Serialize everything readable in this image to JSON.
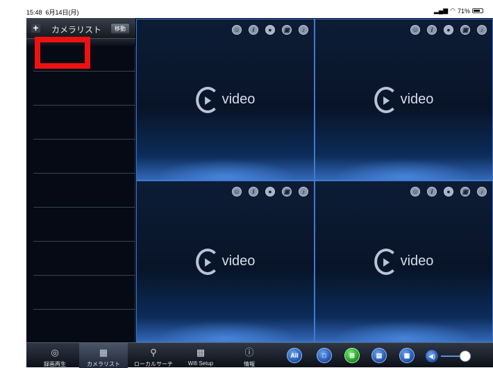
{
  "status": {
    "time": "15:48",
    "date": "6月14日(月)",
    "battery": "71%"
  },
  "sidebar": {
    "title": "カメラリスト",
    "move_label": "移動"
  },
  "video_cells": [
    {
      "label": "video"
    },
    {
      "label": "video"
    },
    {
      "label": "video"
    },
    {
      "label": "video"
    }
  ],
  "cell_icons": [
    "talk-icon",
    "info-icon",
    "record-icon",
    "snapshot-icon",
    "audio-icon"
  ],
  "toolbar": {
    "items": [
      {
        "label": "録画再生",
        "icon": "playback-icon"
      },
      {
        "label": "カメラリスト",
        "icon": "camera-list-icon"
      },
      {
        "label": "ローカルサーチ",
        "icon": "search-icon"
      },
      {
        "label": "Wifi Setup",
        "icon": "qr-code-icon"
      },
      {
        "label": "情報",
        "icon": "info-icon"
      }
    ],
    "all_label": "All"
  },
  "colors": {
    "accent": "#3f7bd0",
    "selected_layout": "#1c8f1c",
    "highlight": "#ee1111"
  }
}
